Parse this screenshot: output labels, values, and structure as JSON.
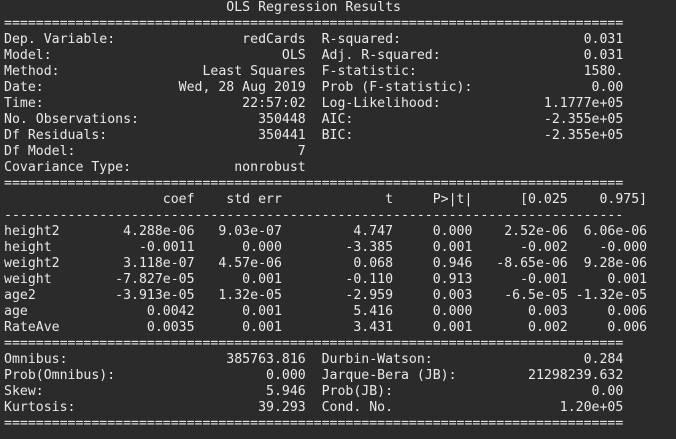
{
  "report": {
    "title": "OLS Regression Results",
    "rule_eq": "==============================================================================",
    "rule_dash": "------------------------------------------------------------------------------"
  },
  "model_summary": [
    {
      "label": "Dep. Variable:",
      "value": "redCards",
      "label2": "R-squared:",
      "value2": "0.031"
    },
    {
      "label": "Model:",
      "value": "OLS",
      "label2": "Adj. R-squared:",
      "value2": "0.031"
    },
    {
      "label": "Method:",
      "value": "Least Squares",
      "label2": "F-statistic:",
      "value2": "1580."
    },
    {
      "label": "Date:",
      "value": "Wed, 28 Aug 2019",
      "label2": "Prob (F-statistic):",
      "value2": "0.00"
    },
    {
      "label": "Time:",
      "value": "22:57:02",
      "label2": "Log-Likelihood:",
      "value2": "1.1777e+05"
    },
    {
      "label": "No. Observations:",
      "value": "350448",
      "label2": "AIC:",
      "value2": "-2.355e+05"
    },
    {
      "label": "Df Residuals:",
      "value": "350441",
      "label2": "BIC:",
      "value2": "-2.355e+05"
    },
    {
      "label": "Df Model:",
      "value": "7",
      "label2": "",
      "value2": ""
    },
    {
      "label": "Covariance Type:",
      "value": "nonrobust",
      "label2": "",
      "value2": ""
    }
  ],
  "coef_table": {
    "headers": [
      "",
      "coef",
      "std err",
      "t",
      "P>|t|",
      "[0.025",
      "0.975]"
    ],
    "rows": [
      [
        "height2",
        "4.288e-06",
        "9.03e-07",
        "4.747",
        "0.000",
        "2.52e-06",
        "6.06e-06"
      ],
      [
        "height",
        "-0.0011",
        "0.000",
        "-3.385",
        "0.001",
        "-0.002",
        "-0.000"
      ],
      [
        "weight2",
        "3.118e-07",
        "4.57e-06",
        "0.068",
        "0.946",
        "-8.65e-06",
        "9.28e-06"
      ],
      [
        "weight",
        "-7.827e-05",
        "0.001",
        "-0.110",
        "0.913",
        "-0.001",
        "0.001"
      ],
      [
        "age2",
        "-3.913e-05",
        "1.32e-05",
        "-2.959",
        "0.003",
        "-6.5e-05",
        "-1.32e-05"
      ],
      [
        "age",
        "0.0042",
        "0.001",
        "5.416",
        "0.000",
        "0.003",
        "0.006"
      ],
      [
        "RateAve",
        "0.0035",
        "0.001",
        "3.431",
        "0.001",
        "0.002",
        "0.006"
      ]
    ]
  },
  "diagnostics": [
    {
      "label": "Omnibus:",
      "value": "385763.816",
      "label2": "Durbin-Watson:",
      "value2": "0.284"
    },
    {
      "label": "Prob(Omnibus):",
      "value": "0.000",
      "label2": "Jarque-Bera (JB):",
      "value2": "21298239.632"
    },
    {
      "label": "Skew:",
      "value": "5.946",
      "label2": "Prob(JB):",
      "value2": "0.00"
    },
    {
      "label": "Kurtosis:",
      "value": "39.293",
      "label2": "Cond. No.",
      "value2": "1.20e+05"
    }
  ]
}
